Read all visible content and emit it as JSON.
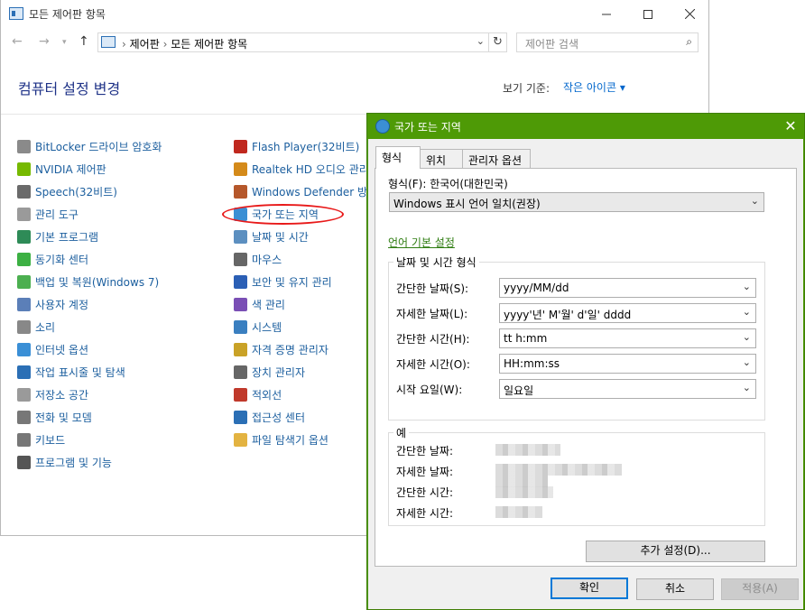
{
  "control_panel": {
    "window_title": "모든 제어판 항목",
    "breadcrumb": [
      "제어판",
      "모든 제어판 항목"
    ],
    "search_placeholder": "제어판 검색",
    "heading": "컴퓨터 설정 변경",
    "view_by_label": "보기 기준:",
    "view_by_value": "작은 아이콘 ▾",
    "items_left": [
      {
        "label": "BitLocker 드라이브 암호화",
        "icon": "bitlocker-icon",
        "color": "#8a8a8a"
      },
      {
        "label": "NVIDIA 제어판",
        "icon": "nvidia-icon",
        "color": "#76b900"
      },
      {
        "label": "Speech(32비트)",
        "icon": "speech-icon",
        "color": "#6a6a6a"
      },
      {
        "label": "관리 도구",
        "icon": "admin-tools-icon",
        "color": "#9a9a9a"
      },
      {
        "label": "기본 프로그램",
        "icon": "default-programs-icon",
        "color": "#2e8b57"
      },
      {
        "label": "동기화 센터",
        "icon": "sync-center-icon",
        "color": "#3cb043"
      },
      {
        "label": "백업 및 복원(Windows 7)",
        "icon": "backup-icon",
        "color": "#4caf50"
      },
      {
        "label": "사용자 계정",
        "icon": "user-accounts-icon",
        "color": "#5b7fb8"
      },
      {
        "label": "소리",
        "icon": "sound-icon",
        "color": "#888888"
      },
      {
        "label": "인터넷 옵션",
        "icon": "internet-options-icon",
        "color": "#3a8fd6"
      },
      {
        "label": "작업 표시줄 및 탐색",
        "icon": "taskbar-icon",
        "color": "#2b6fb5"
      },
      {
        "label": "저장소 공간",
        "icon": "storage-spaces-icon",
        "color": "#9a9a9a"
      },
      {
        "label": "전화 및 모뎀",
        "icon": "phone-modem-icon",
        "color": "#777777"
      },
      {
        "label": "키보드",
        "icon": "keyboard-icon",
        "color": "#777777"
      },
      {
        "label": "프로그램 및 기능",
        "icon": "programs-features-icon",
        "color": "#555555"
      }
    ],
    "items_right": [
      {
        "label": "Flash Player(32비트)",
        "icon": "flash-icon",
        "color": "#c0281e"
      },
      {
        "label": "Realtek HD 오디오 관리",
        "icon": "realtek-icon",
        "color": "#d48a1a"
      },
      {
        "label": "Windows Defender 방화",
        "icon": "firewall-icon",
        "color": "#b5572b"
      },
      {
        "label": "국가 또는 지역",
        "icon": "region-icon",
        "color": "#3b8fd4"
      },
      {
        "label": "날짜 및 시간",
        "icon": "date-time-icon",
        "color": "#5c8fc0"
      },
      {
        "label": "마우스",
        "icon": "mouse-icon",
        "color": "#666666"
      },
      {
        "label": "보안 및 유지 관리",
        "icon": "security-maintenance-icon",
        "color": "#2b5fb5"
      },
      {
        "label": "색 관리",
        "icon": "color-management-icon",
        "color": "#7a4fb5"
      },
      {
        "label": "시스템",
        "icon": "system-icon",
        "color": "#3a7fc0"
      },
      {
        "label": "자격 증명 관리자",
        "icon": "credential-manager-icon",
        "color": "#c9a227"
      },
      {
        "label": "장치 관리자",
        "icon": "device-manager-icon",
        "color": "#666666"
      },
      {
        "label": "적외선",
        "icon": "infrared-icon",
        "color": "#c0392b"
      },
      {
        "label": "접근성 센터",
        "icon": "ease-of-access-icon",
        "color": "#2b6fb5"
      },
      {
        "label": "파일 탐색기 옵션",
        "icon": "file-explorer-options-icon",
        "color": "#e3b341"
      }
    ]
  },
  "region_dialog": {
    "title": "국가 또는 지역",
    "close": "✕",
    "tabs": [
      "형식",
      "위치",
      "관리자 옵션"
    ],
    "format_label": "형식(F): 한국어(대한민국)",
    "format_value": "Windows 표시 언어 일치(권장)",
    "language_pref_link": "언어 기본 설정",
    "datetime_group_title": "날짜 및 시간 형식",
    "fields": [
      {
        "label": "간단한 날짜(S):",
        "value": "yyyy/MM/dd"
      },
      {
        "label": "자세한 날짜(L):",
        "value": "yyyy'년' M'월' d'일' dddd"
      },
      {
        "label": "간단한 시간(H):",
        "value": "tt h:mm"
      },
      {
        "label": "자세한 시간(O):",
        "value": "HH:mm:ss"
      },
      {
        "label": "시작 요일(W):",
        "value": "일요일"
      }
    ],
    "example_group_title": "예",
    "example_labels": [
      "간단한 날짜:",
      "자세한 날짜:",
      "간단한 시간:",
      "자세한 시간:"
    ],
    "additional_settings": "추가 설정(D)...",
    "buttons": {
      "ok": "확인",
      "cancel": "취소",
      "apply": "적용(A)"
    }
  }
}
